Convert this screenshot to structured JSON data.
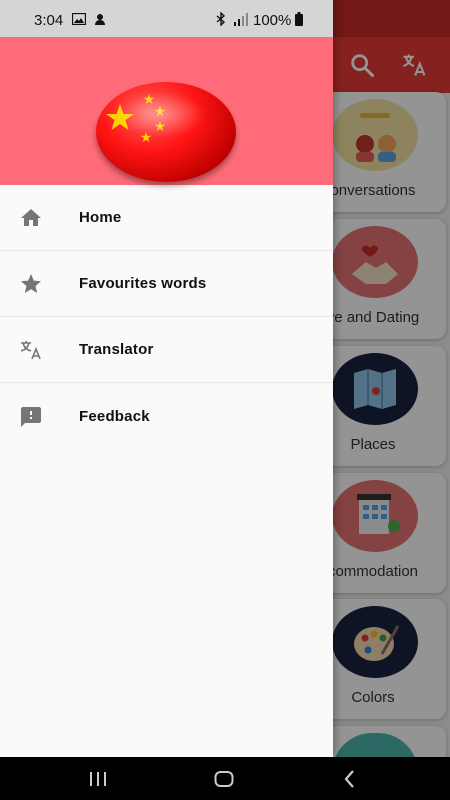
{
  "status_bar": {
    "time": "3:04",
    "battery": "100%"
  },
  "drawer": {
    "header_flag": "china-flag",
    "items": [
      {
        "label": "Home",
        "icon": "home-icon"
      },
      {
        "label": "Favourites words",
        "icon": "star-icon"
      },
      {
        "label": "Translator",
        "icon": "translate-icon"
      },
      {
        "label": "Feedback",
        "icon": "feedback-icon"
      }
    ]
  },
  "background_categories": [
    {
      "label": "Conversations",
      "visible_label": "onversations"
    },
    {
      "label": "Love and Dating",
      "visible_label": "ve and Dating"
    },
    {
      "label": "Places",
      "visible_label": "Places"
    },
    {
      "label": "Accommodation",
      "visible_label": "commodation"
    },
    {
      "label": "Colors",
      "visible_label": "Colors"
    }
  ],
  "colors": {
    "accent_red": "#e53935",
    "header_pink": "#ff6b78",
    "drawer_bg": "#fafafa"
  }
}
